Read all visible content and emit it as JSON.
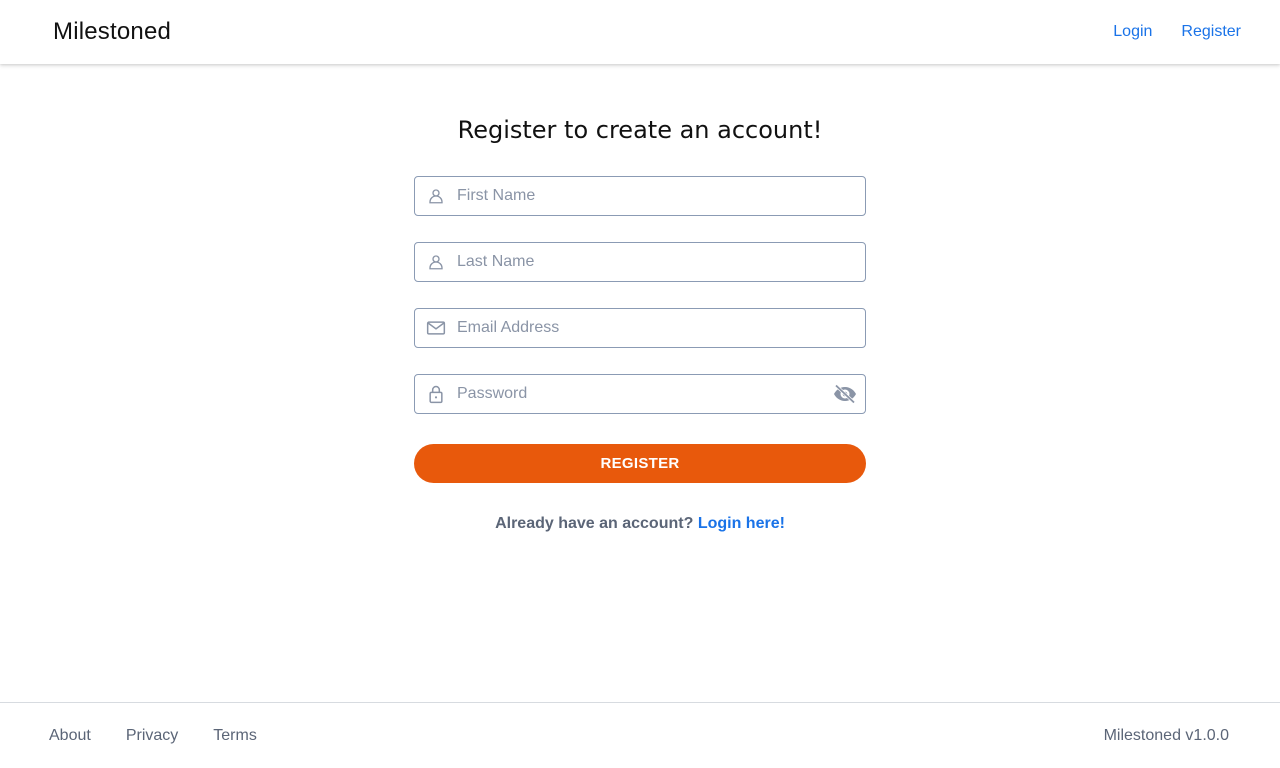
{
  "navbar": {
    "brand": "Milestoned",
    "links": [
      "Login",
      "Register"
    ]
  },
  "form": {
    "title": "Register to create an account!",
    "first_name": {
      "placeholder": "First Name",
      "value": "",
      "icon": "user-icon"
    },
    "last_name": {
      "placeholder": "Last Name",
      "value": "",
      "icon": "user-icon"
    },
    "email": {
      "placeholder": "Email Address",
      "value": "",
      "icon": "mail-icon"
    },
    "password": {
      "placeholder": "Password",
      "value": "",
      "icon": "lock-icon",
      "toggle_icon": "eye-off-icon"
    },
    "submit_label": "REGISTER",
    "switch_prompt": "Already have an account?",
    "switch_link": "Login here!"
  },
  "footer": {
    "links": [
      "About",
      "Privacy",
      "Terms"
    ],
    "version": "Milestoned v1.0.0"
  },
  "colors": {
    "accent": "#e8590c",
    "link": "#1a73e8",
    "muted_text": "#5b6577",
    "input_border": "#8b9bb4"
  }
}
